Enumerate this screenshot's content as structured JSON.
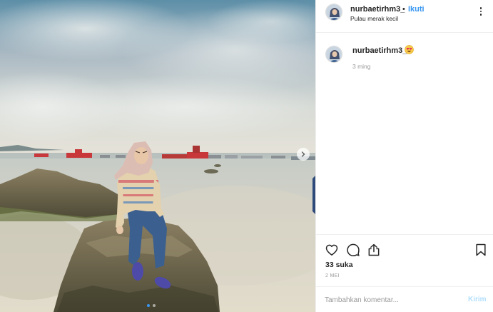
{
  "post": {
    "username": "nurbaetirhm3_",
    "separator": "•",
    "follow_label": "Ikuti",
    "location": "Pulau merak kecil",
    "more_icon": "more-horizontal-icon"
  },
  "caption": {
    "username": "nurbaetirhm3_",
    "emoji": "heart-eyes-emoji",
    "time": "3 ming"
  },
  "actions": {
    "icons": [
      "heart-icon",
      "comment-icon",
      "share-icon",
      "bookmark-icon"
    ],
    "likes": "33 suka",
    "date": "2 MEI"
  },
  "comment_box": {
    "placeholder": "Tambahkan komentar...",
    "post_label": "Kirim"
  },
  "carousel": {
    "slides": 2,
    "active_index": 0
  },
  "colors": {
    "accent": "#3897f0",
    "text": "#262626",
    "muted": "#999999",
    "post_disabled": "#b2dffc"
  }
}
